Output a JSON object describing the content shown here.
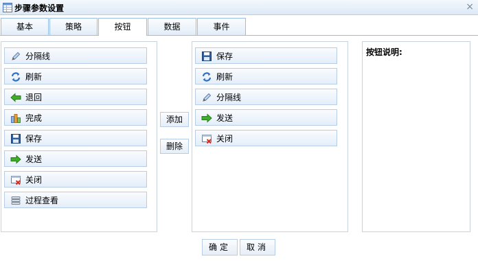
{
  "window": {
    "title": "步骤参数设置",
    "close_glyph": "×",
    "title_icon": "table-icon"
  },
  "tabs": [
    {
      "label": "基本"
    },
    {
      "label": "策略"
    },
    {
      "label": "按钮",
      "active": true
    },
    {
      "label": "数据"
    },
    {
      "label": "事件"
    }
  ],
  "available_buttons": [
    {
      "label": "分隔线",
      "icon": "pencil-icon"
    },
    {
      "label": "刷新",
      "icon": "refresh-icon"
    },
    {
      "label": "退回",
      "icon": "arrow-left-icon"
    },
    {
      "label": "完成",
      "icon": "complete-icon"
    },
    {
      "label": "保存",
      "icon": "save-icon"
    },
    {
      "label": "发送",
      "icon": "arrow-right-icon"
    },
    {
      "label": "关闭",
      "icon": "close-window-icon"
    },
    {
      "label": "过程查看",
      "icon": "list-icon"
    }
  ],
  "actions": {
    "add_label": "添加",
    "delete_label": "删除"
  },
  "selected_buttons": [
    {
      "label": "保存",
      "icon": "save-icon"
    },
    {
      "label": "刷新",
      "icon": "refresh-icon"
    },
    {
      "label": "分隔线",
      "icon": "pencil-icon"
    },
    {
      "label": "发送",
      "icon": "arrow-right-icon"
    },
    {
      "label": "关闭",
      "icon": "close-window-icon"
    }
  ],
  "description": {
    "label": "按钮说明:"
  },
  "footer": {
    "ok_label": "确定",
    "cancel_label": "取消"
  },
  "colors": {
    "tab_border": "#99bbe8",
    "button_border": "#b7cde6",
    "green_arrow": "#3fae2a",
    "blue_icon": "#2f6fc4",
    "red_x": "#d42b1e"
  }
}
